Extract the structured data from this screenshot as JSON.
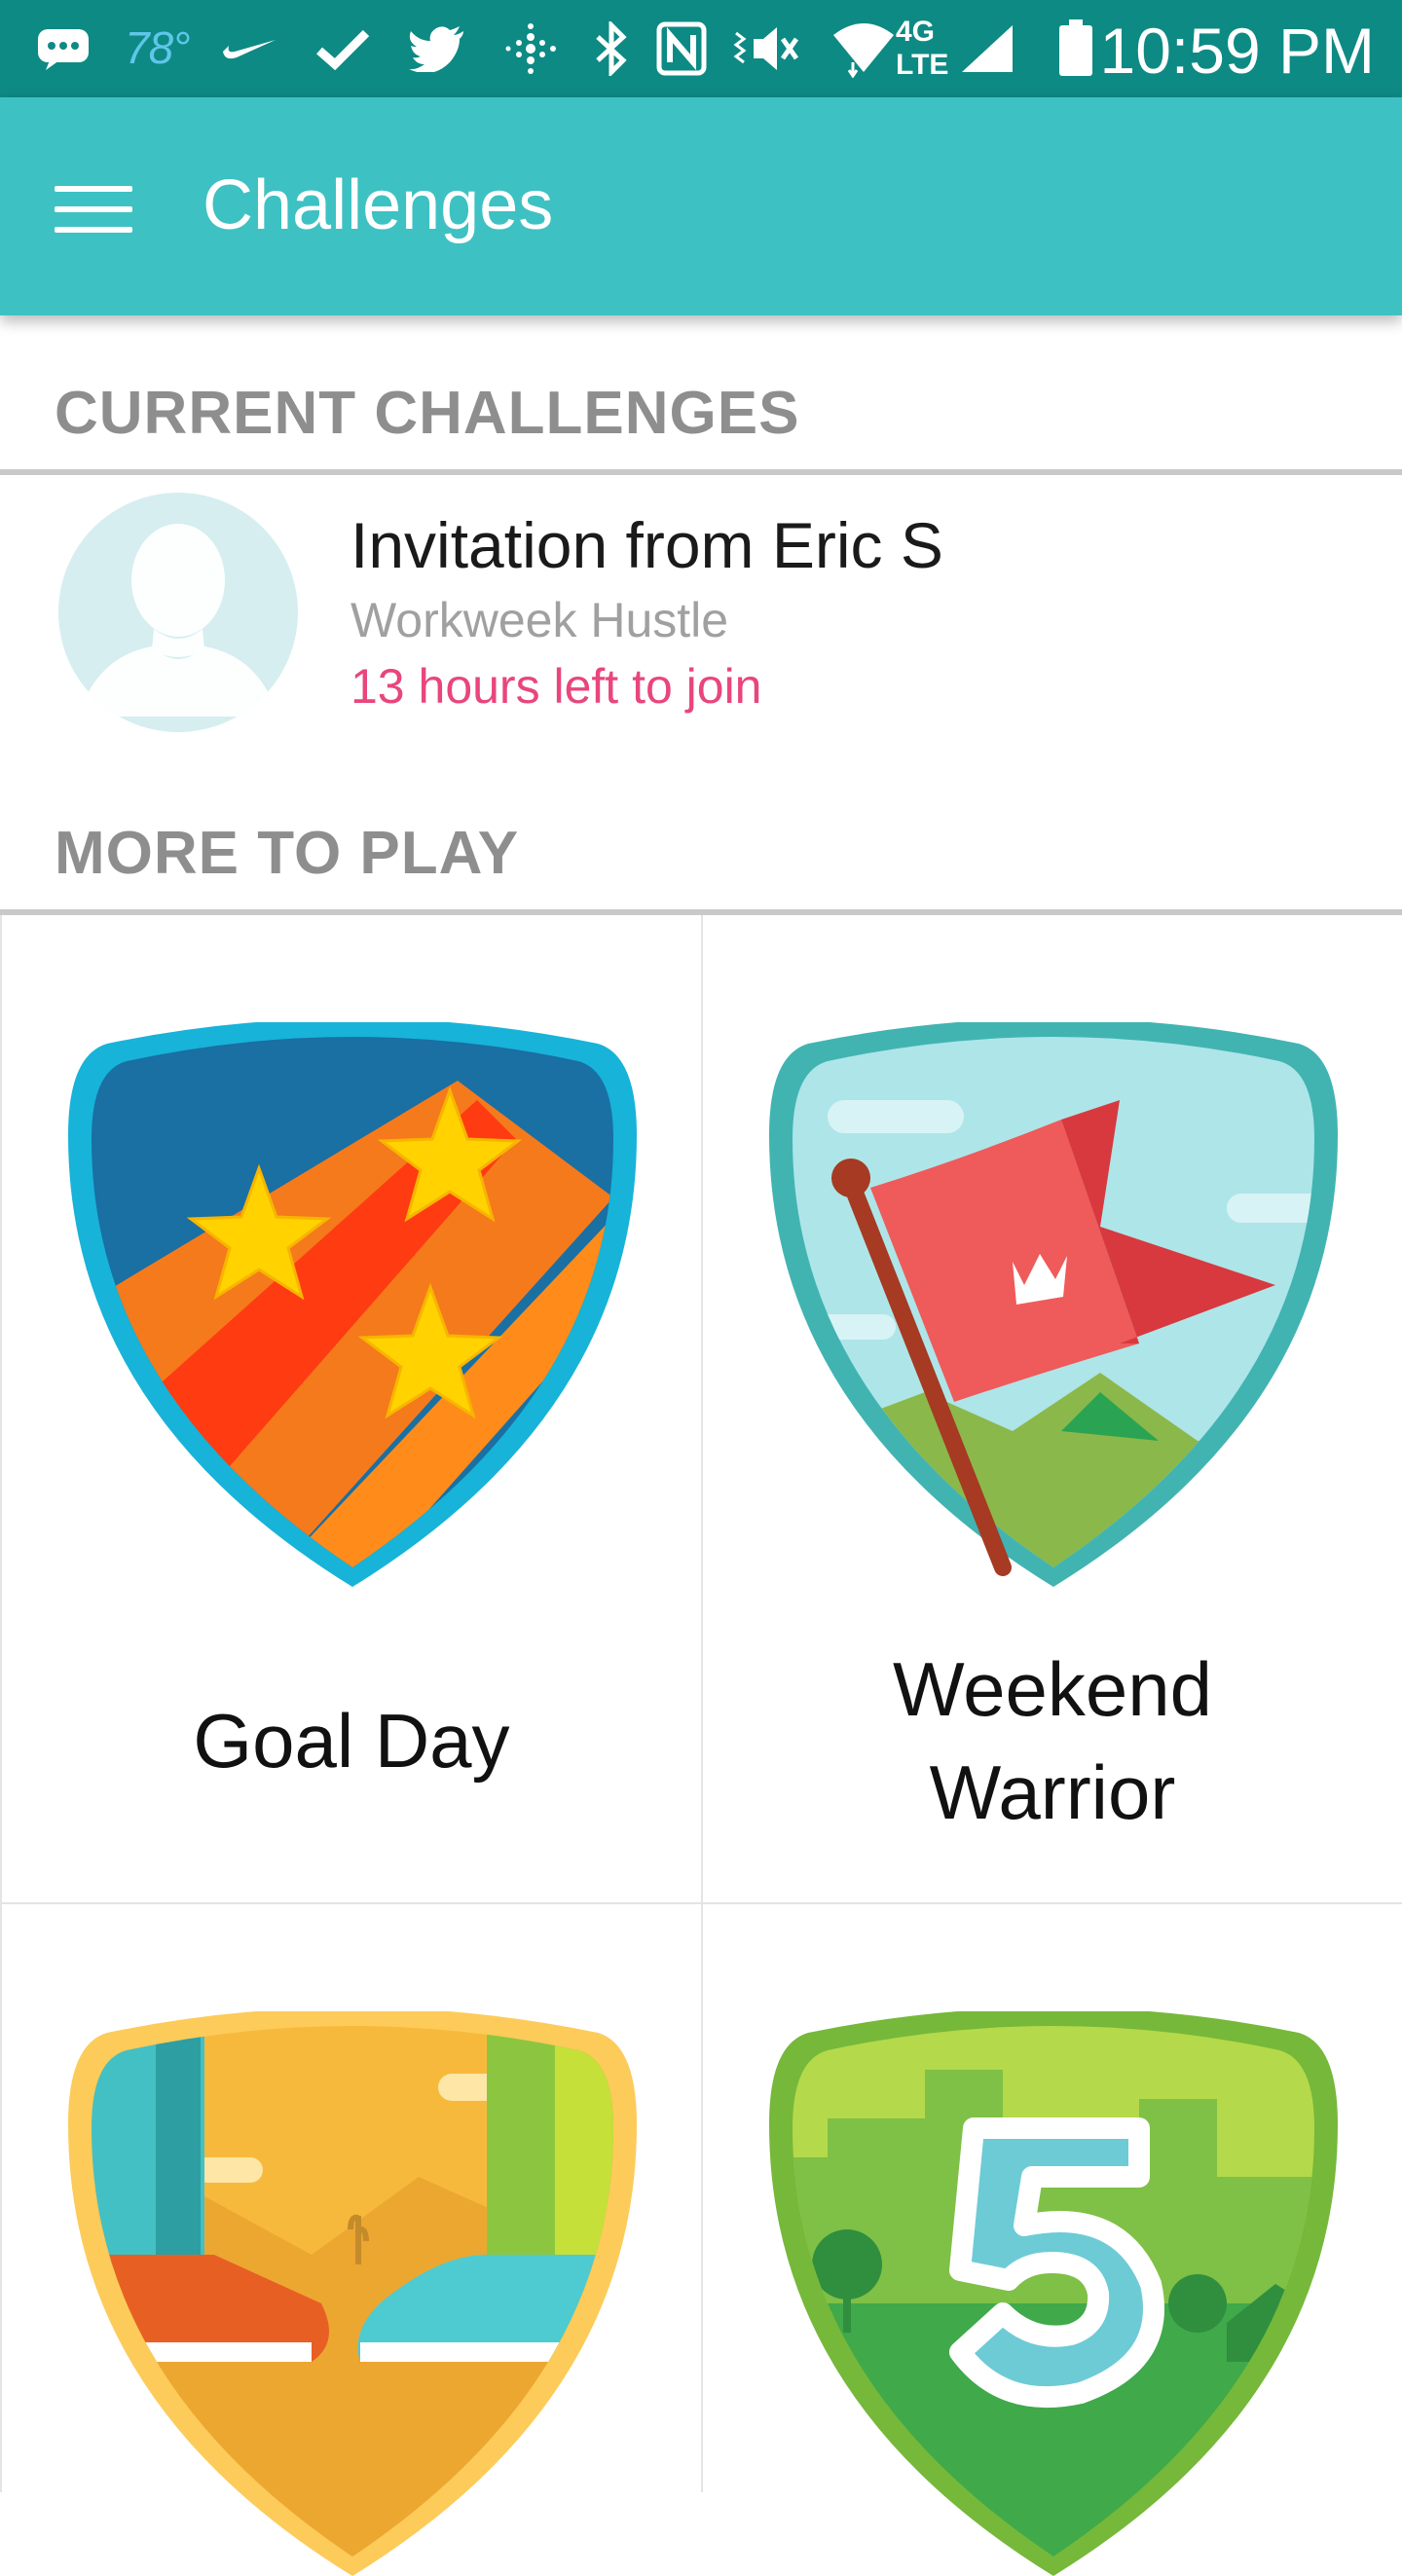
{
  "status_bar": {
    "temperature": "78°",
    "time": "10:59 PM",
    "network": "4G LTE",
    "icons": [
      "message-icon",
      "nike-icon",
      "check-icon",
      "twitter-icon",
      "fitbit-icon",
      "bluetooth-icon",
      "nfc-icon",
      "vibrate-icon",
      "wifi-icon",
      "signal-icon",
      "battery-icon"
    ]
  },
  "app_bar": {
    "title": "Challenges"
  },
  "current_challenges": {
    "header": "CURRENT CHALLENGES",
    "invitation": {
      "title": "Invitation from Eric S",
      "challenge_name": "Workweek Hustle",
      "deadline": "13 hours left to join"
    }
  },
  "more_to_play": {
    "header": "MORE TO PLAY",
    "tiles": [
      {
        "label_lines": [
          "Goal Day"
        ],
        "badge": "goal-day-badge"
      },
      {
        "label_lines": [
          "Weekend",
          "Warrior"
        ],
        "badge": "weekend-warrior-badge"
      },
      {
        "label_lines": [],
        "badge": "daily-showdown-badge"
      },
      {
        "label_lines": [],
        "badge": "five-badge"
      }
    ]
  },
  "colors": {
    "status_bar": "#0e8a84",
    "app_bar": "#3ec1c2",
    "deadline": "#e8467c",
    "section_header": "#8e8e8e"
  }
}
